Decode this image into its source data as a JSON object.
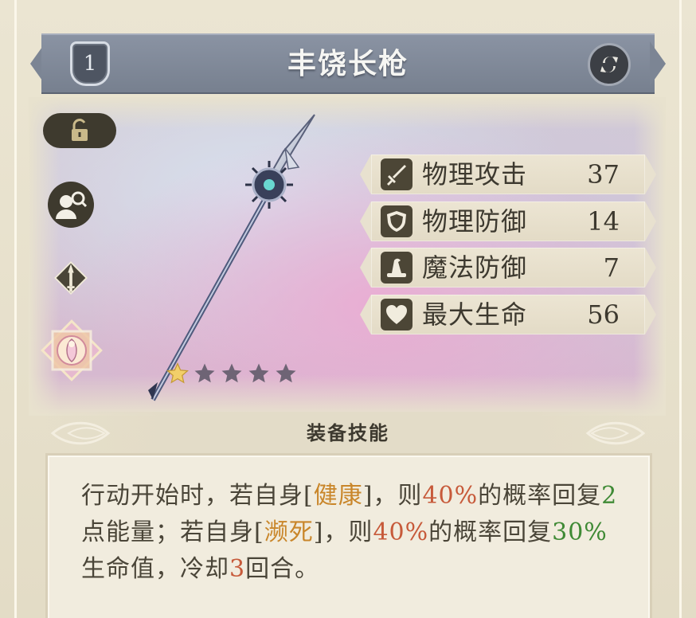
{
  "header": {
    "level": "1",
    "title": "丰饶长枪",
    "swap_icon": "swap-icon"
  },
  "sidebar": {
    "lock_icon": "unlock-icon",
    "inspect_icon": "character-inspect-icon",
    "type_icon": "spear-type-icon",
    "emblem_icon": "flower-emblem-icon"
  },
  "item": {
    "image": "spear-weapon-illustration",
    "stars_filled": 1,
    "stars_total": 5
  },
  "stats": [
    {
      "icon": "sword-icon",
      "label": "物理攻击",
      "value": "37"
    },
    {
      "icon": "shield-icon",
      "label": "物理防御",
      "value": "14"
    },
    {
      "icon": "wizard-hat-icon",
      "label": "魔法防御",
      "value": "7"
    },
    {
      "icon": "heart-icon",
      "label": "最大生命",
      "value": "56"
    }
  ],
  "skill": {
    "header": "装备技能",
    "segments": [
      {
        "text": "行动开始时，若自身[",
        "style": "normal"
      },
      {
        "text": "健康",
        "style": "orange"
      },
      {
        "text": "]，则",
        "style": "normal"
      },
      {
        "text": "40%",
        "style": "red"
      },
      {
        "text": "的概率回复",
        "style": "normal"
      },
      {
        "text": "2",
        "style": "green"
      },
      {
        "text": "点能量；若自身[",
        "style": "normal"
      },
      {
        "text": "濒死",
        "style": "orange"
      },
      {
        "text": "]，则",
        "style": "normal"
      },
      {
        "text": "40%",
        "style": "red"
      },
      {
        "text": "的概率回复",
        "style": "normal"
      },
      {
        "text": "30%",
        "style": "green"
      },
      {
        "text": "生命值，冷却",
        "style": "normal"
      },
      {
        "text": "3",
        "style": "red"
      },
      {
        "text": "回合。",
        "style": "normal"
      }
    ]
  },
  "colors": {
    "accent_orange": "#c9862a",
    "accent_red": "#c75a3a",
    "accent_green": "#3f8a35",
    "banner": "#7c8594"
  }
}
